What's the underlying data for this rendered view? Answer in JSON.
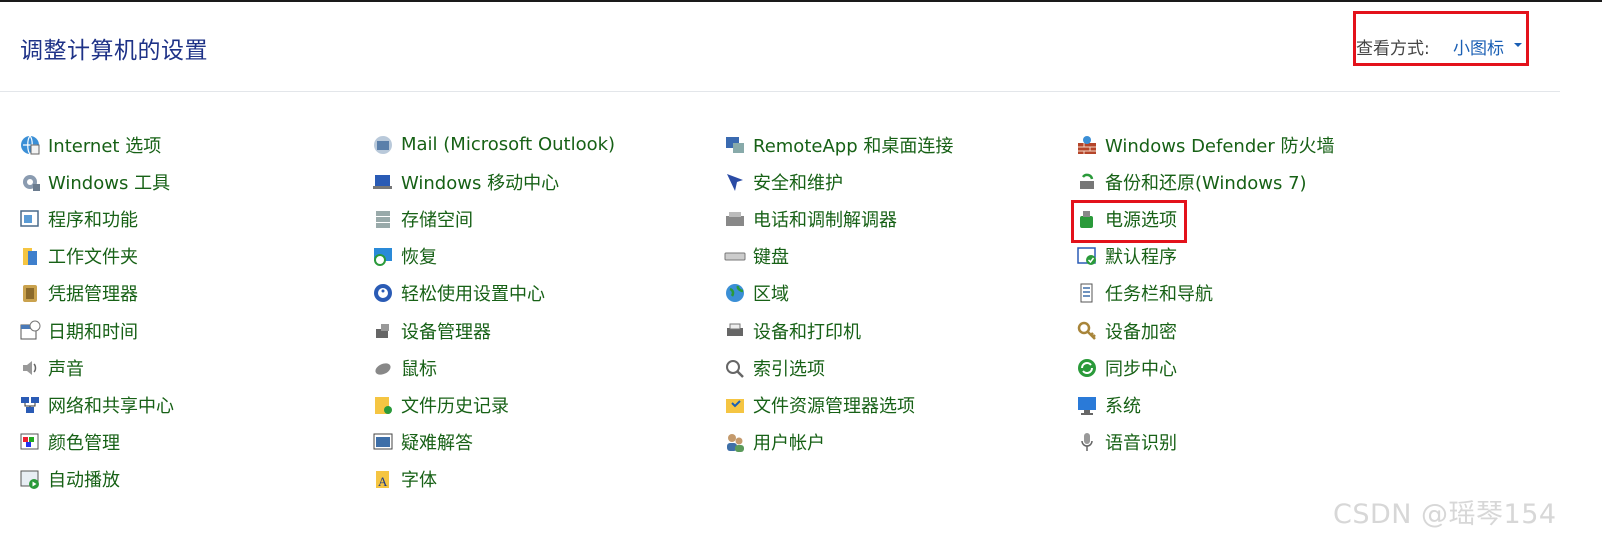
{
  "header": {
    "title": "调整计算机的设置",
    "view_label": "查看方式:",
    "view_value": "小图标"
  },
  "columns": [
    {
      "items": [
        {
          "label": "Internet 选项",
          "icon": "internet-options-icon"
        },
        {
          "label": "Windows 工具",
          "icon": "windows-tools-icon"
        },
        {
          "label": "程序和功能",
          "icon": "programs-features-icon"
        },
        {
          "label": "工作文件夹",
          "icon": "work-folders-icon"
        },
        {
          "label": "凭据管理器",
          "icon": "credential-manager-icon"
        },
        {
          "label": "日期和时间",
          "icon": "date-time-icon"
        },
        {
          "label": "声音",
          "icon": "sound-icon"
        },
        {
          "label": "网络和共享中心",
          "icon": "network-sharing-icon"
        },
        {
          "label": "颜色管理",
          "icon": "color-management-icon"
        },
        {
          "label": "自动播放",
          "icon": "autoplay-icon"
        }
      ]
    },
    {
      "items": [
        {
          "label": "Mail (Microsoft Outlook)",
          "icon": "mail-icon"
        },
        {
          "label": "Windows 移动中心",
          "icon": "mobility-center-icon"
        },
        {
          "label": "存储空间",
          "icon": "storage-spaces-icon"
        },
        {
          "label": "恢复",
          "icon": "recovery-icon"
        },
        {
          "label": "轻松使用设置中心",
          "icon": "ease-of-access-icon"
        },
        {
          "label": "设备管理器",
          "icon": "device-manager-icon"
        },
        {
          "label": "鼠标",
          "icon": "mouse-icon"
        },
        {
          "label": "文件历史记录",
          "icon": "file-history-icon"
        },
        {
          "label": "疑难解答",
          "icon": "troubleshooting-icon"
        },
        {
          "label": "字体",
          "icon": "fonts-icon"
        }
      ]
    },
    {
      "items": [
        {
          "label": "RemoteApp 和桌面连接",
          "icon": "remoteapp-icon"
        },
        {
          "label": "安全和维护",
          "icon": "security-maintenance-icon"
        },
        {
          "label": "电话和调制解调器",
          "icon": "phone-modem-icon"
        },
        {
          "label": "键盘",
          "icon": "keyboard-icon"
        },
        {
          "label": "区域",
          "icon": "region-icon"
        },
        {
          "label": "设备和打印机",
          "icon": "devices-printers-icon"
        },
        {
          "label": "索引选项",
          "icon": "indexing-options-icon"
        },
        {
          "label": "文件资源管理器选项",
          "icon": "file-explorer-options-icon"
        },
        {
          "label": "用户帐户",
          "icon": "user-accounts-icon"
        }
      ]
    },
    {
      "items": [
        {
          "label": "Windows Defender 防火墙",
          "icon": "firewall-icon"
        },
        {
          "label": "备份和还原(Windows 7)",
          "icon": "backup-restore-icon"
        },
        {
          "label": "电源选项",
          "icon": "power-options-icon"
        },
        {
          "label": "默认程序",
          "icon": "default-programs-icon"
        },
        {
          "label": "任务栏和导航",
          "icon": "taskbar-navigation-icon"
        },
        {
          "label": "设备加密",
          "icon": "device-encryption-icon"
        },
        {
          "label": "同步中心",
          "icon": "sync-center-icon"
        },
        {
          "label": "系统",
          "icon": "system-icon"
        },
        {
          "label": "语音识别",
          "icon": "speech-recognition-icon"
        }
      ]
    }
  ],
  "watermark": "CSDN @瑶琴154",
  "colors": {
    "title": "#1e3287",
    "link": "#176116",
    "view_value": "#1a5fb4",
    "highlight_box": "#e3121b"
  }
}
